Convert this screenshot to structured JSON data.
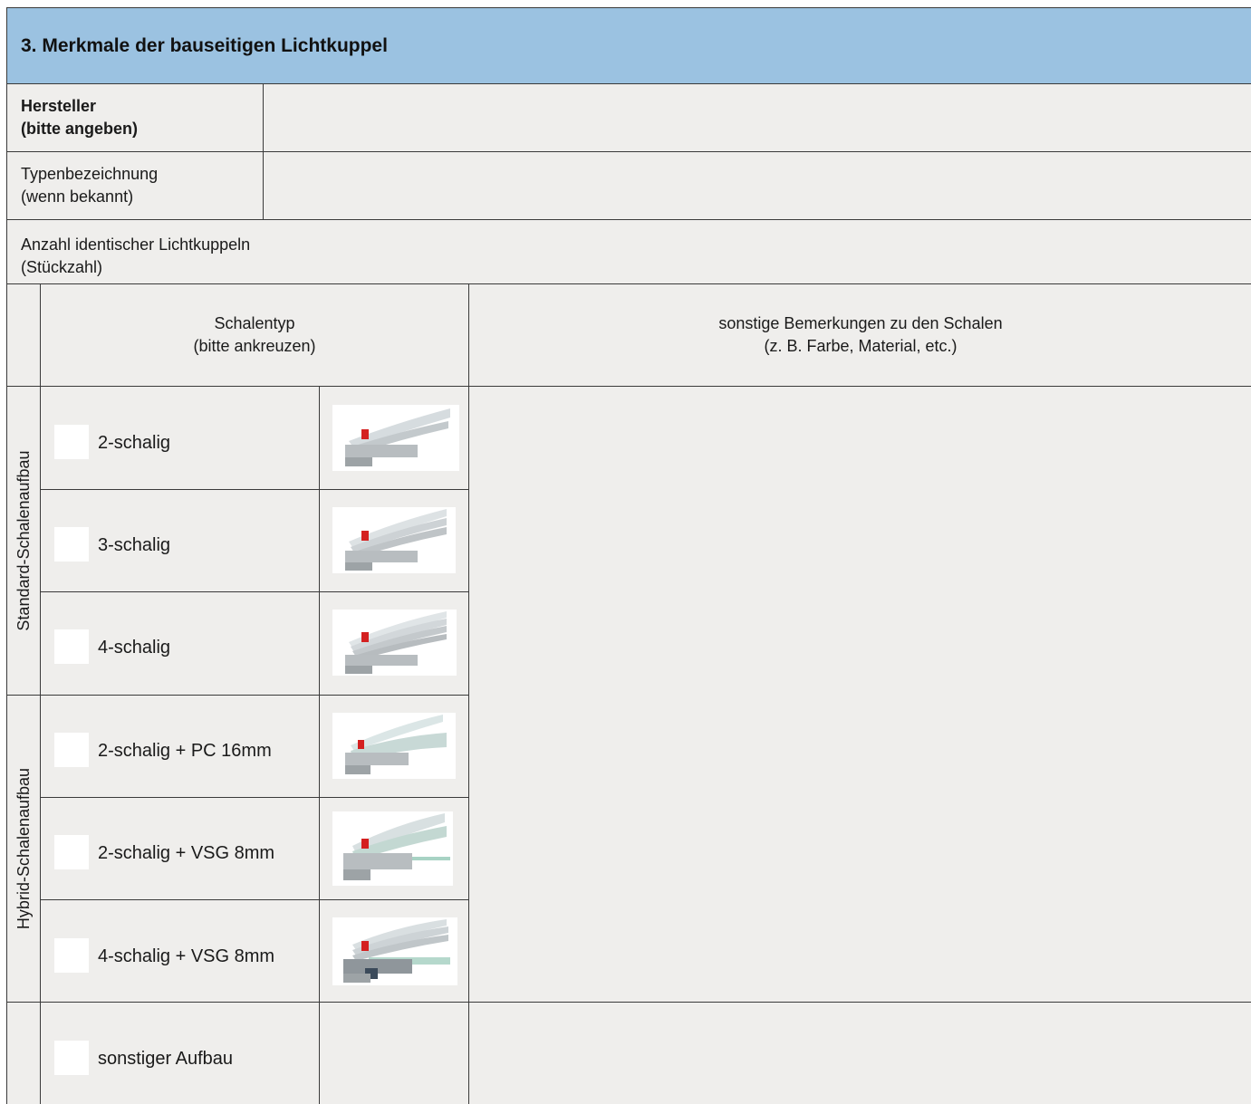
{
  "section_title": "3. Merkmale der bauseitigen Lichtkuppel",
  "manufacturer": {
    "label_line1": "Hersteller",
    "label_line2": "(bitte angeben)",
    "value": ""
  },
  "type_designation": {
    "label_line1": "Typenbezeichnung",
    "label_line2": "(wenn bekannt)",
    "value": ""
  },
  "quantity": {
    "label_line1": "Anzahl identischer Lichtkuppeln",
    "label_line2": "(Stückzahl)",
    "value": ""
  },
  "shell_type_header": {
    "line1": "Schalentyp",
    "line2": "(bitte ankreuzen)"
  },
  "remarks_header": {
    "line1": "sonstige Bemerkungen zu den Schalen",
    "line2": "(z. B. Farbe, Material, etc.)"
  },
  "groups": {
    "standard": "Standard-Schalenaufbau",
    "hybrid": "Hybrid-Schalenaufbau"
  },
  "options": [
    {
      "label": "2-schalig",
      "checked": false,
      "icon": "2-shell-profile-image"
    },
    {
      "label": "3-schalig",
      "checked": false,
      "icon": "3-shell-profile-image"
    },
    {
      "label": "4-schalig",
      "checked": false,
      "icon": "4-shell-profile-image"
    },
    {
      "label": "2-schalig + PC 16mm",
      "checked": false,
      "icon": "2-shell-pc-profile-image"
    },
    {
      "label": "2-schalig + VSG 8mm",
      "checked": false,
      "icon": "2-shell-vsg-profile-image"
    },
    {
      "label": "4-schalig + VSG 8mm",
      "checked": false,
      "icon": "4-shell-vsg-profile-image"
    },
    {
      "label": "sonstiger Aufbau",
      "checked": false,
      "icon": ""
    }
  ],
  "colors": {
    "header_bg": "#9bc2e1",
    "form_bg": "#efeeec",
    "border": "#3a3a3a",
    "checkbox_bg": "#ffffff"
  }
}
